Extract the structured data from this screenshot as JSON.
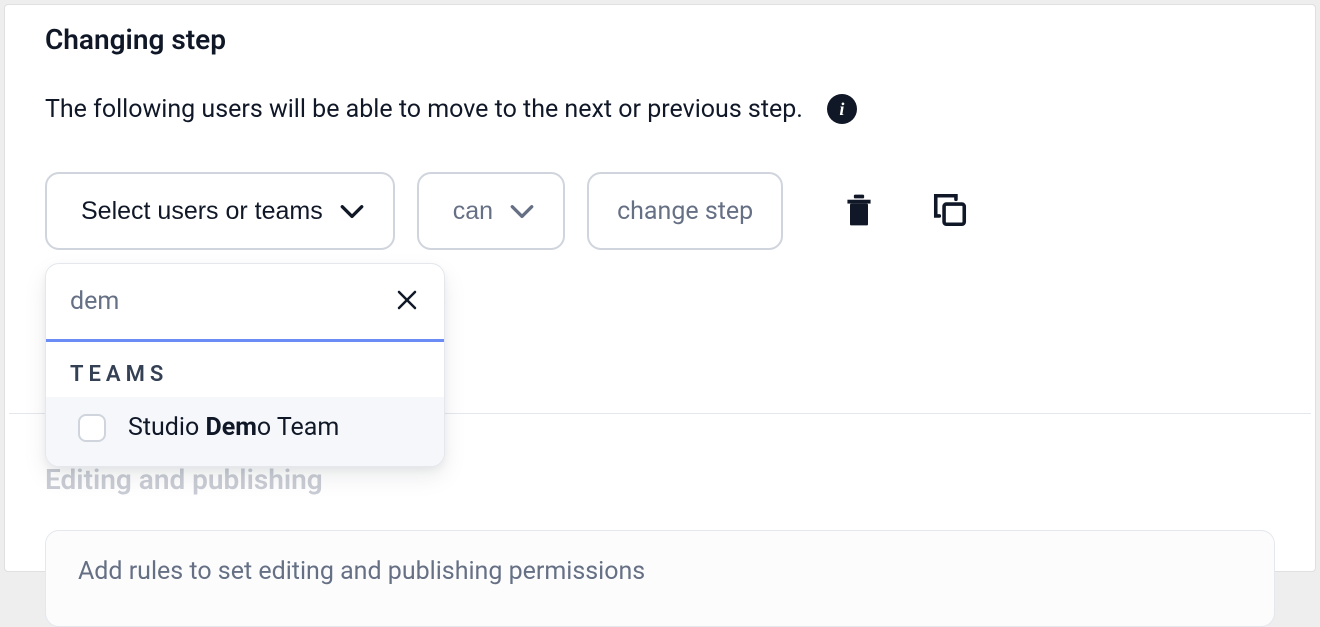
{
  "section": {
    "title": "Changing step",
    "description": "The following users will be able to move to the next or previous step."
  },
  "controls": {
    "select_label": "Select users or teams",
    "can_label": "can",
    "action_label": "change step"
  },
  "search": {
    "value": "dem",
    "group_label": "TEAMS",
    "option": {
      "pre": "Studio ",
      "match": "Dem",
      "post": "o Team"
    }
  },
  "editing": {
    "title": "Editing and publishing",
    "rules_text": "Add rules to set editing and publishing permissions"
  }
}
